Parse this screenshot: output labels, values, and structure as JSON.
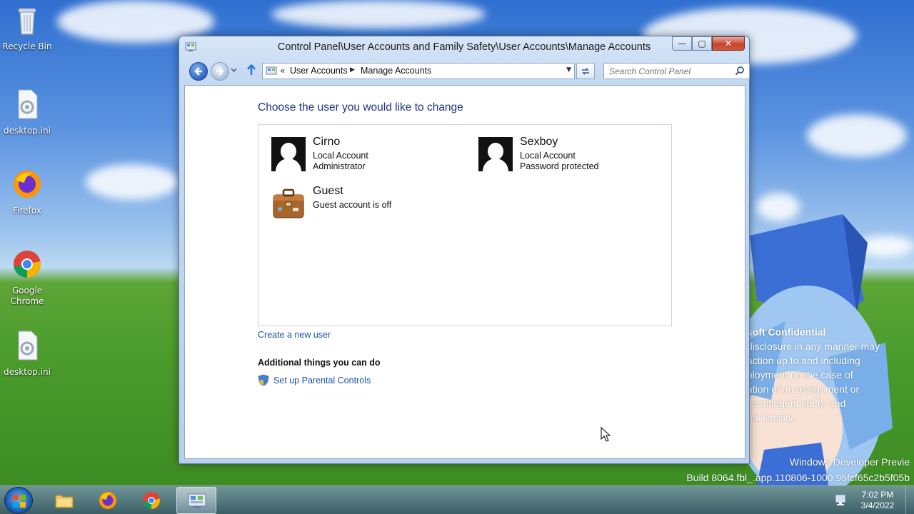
{
  "desktop": {
    "icons": [
      {
        "label": "Recycle Bin",
        "icon": "recycle-bin-icon"
      },
      {
        "label": "desktop.ini",
        "icon": "settings-file-icon"
      },
      {
        "label": "Firefox",
        "icon": "firefox-icon"
      },
      {
        "label": "Google Chrome",
        "icon": "chrome-icon"
      },
      {
        "label": "desktop.ini",
        "icon": "settings-file-icon"
      }
    ],
    "watermark": {
      "title": "soft Confidential",
      "lines": [
        "disclosure in any manner may",
        "action up to and including",
        "ployment (in the case of",
        "ation of an assignment or",
        "f contingent staff), and",
        "nal liability."
      ]
    },
    "build_info": {
      "line1": "Windows Developer Previe",
      "line2": "Build 8064.fbl_.app.110806-1000.95fcf65c2b5f05b"
    }
  },
  "window": {
    "title": "Control Panel\\User Accounts and Family Safety\\User Accounts\\Manage Accounts",
    "buttons": {
      "minimize": "—",
      "maximize": "▢",
      "close": "✕"
    },
    "address": {
      "chevron": "«",
      "crumbs": [
        "User Accounts",
        "Manage Accounts"
      ]
    },
    "search": {
      "placeholder": "Search Control Panel"
    },
    "content": {
      "heading": "Choose the user you would like to change",
      "users": [
        {
          "name": "Cirno",
          "line1": "Local Account",
          "line2": "Administrator",
          "icon": "user-silhouette-icon"
        },
        {
          "name": "Sexboy",
          "line1": "Local Account",
          "line2": "Password protected",
          "icon": "user-silhouette-icon"
        },
        {
          "name": "Guest",
          "line1": "Guest account is off",
          "line2": "",
          "icon": "briefcase-icon"
        }
      ],
      "create_link": "Create a new user",
      "additional_heading": "Additional things you can do",
      "parental_link": "Set up Parental Controls"
    }
  },
  "taskbar": {
    "items": [
      {
        "name": "file-explorer",
        "icon": "folder-icon"
      },
      {
        "name": "firefox",
        "icon": "firefox-icon"
      },
      {
        "name": "chrome",
        "icon": "chrome-icon"
      },
      {
        "name": "control-panel",
        "icon": "control-panel-icon",
        "active": true
      }
    ],
    "clock": {
      "time": "7:02 PM",
      "date": "3/4/2022"
    }
  },
  "colors": {
    "heading": "#1e3287",
    "link": "#1a55a8",
    "close_button": "#c7432c"
  }
}
